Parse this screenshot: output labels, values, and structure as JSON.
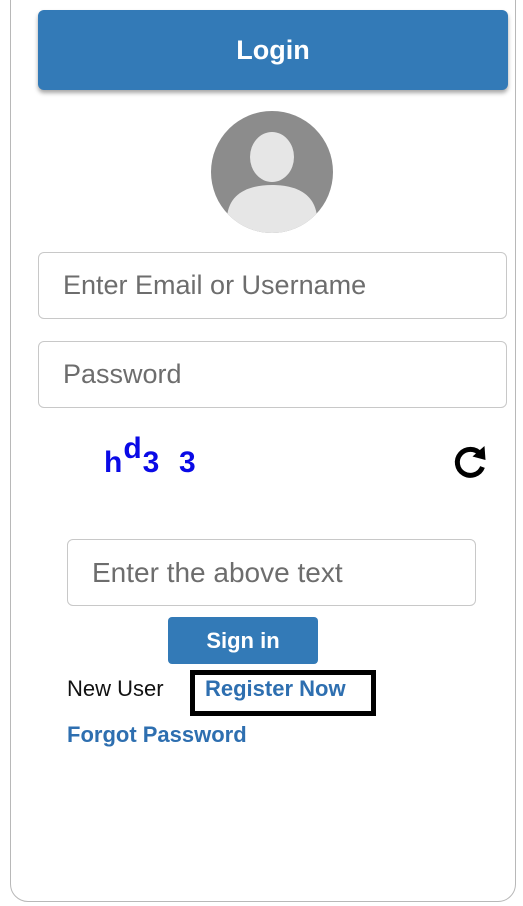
{
  "header": {
    "title": "Login"
  },
  "form": {
    "email_placeholder": "Enter Email or Username",
    "password_placeholder": "Password",
    "captcha_placeholder": "Enter the above text",
    "signin_label": "Sign in"
  },
  "captcha": {
    "part1": "h",
    "part2": "d",
    "part3": "3  3"
  },
  "links": {
    "new_user_label": "New User",
    "register_label": "Register Now",
    "forgot_label": "Forgot Password"
  },
  "icons": {
    "avatar": "user-avatar-icon",
    "refresh": "refresh-icon"
  },
  "colors": {
    "primary": "#337ab7",
    "link": "#2e6fb0",
    "captcha": "#0a0ae6",
    "avatar_bg": "#8c8c8c",
    "avatar_fg": "#e6e6e6"
  }
}
